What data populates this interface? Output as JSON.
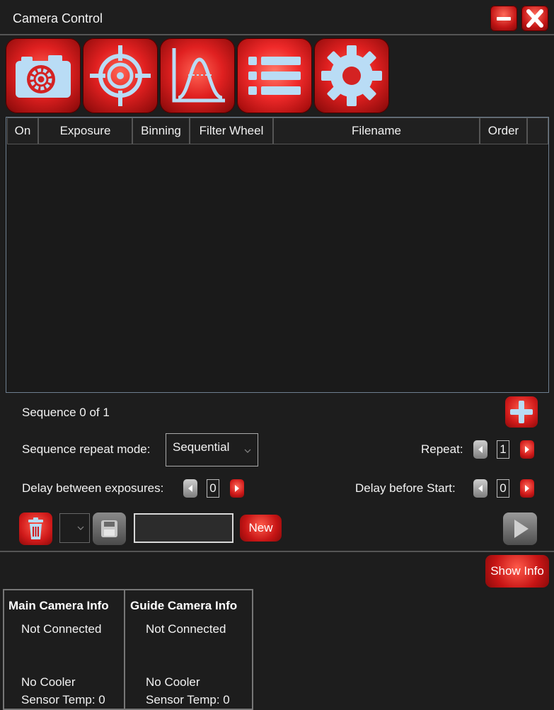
{
  "window": {
    "title": "Camera Control",
    "minimize_icon": "minimize-icon",
    "close_icon": "close-icon"
  },
  "toolbar": {
    "buttons": [
      {
        "icon": "camera-settings-icon"
      },
      {
        "icon": "crosshair-target-icon"
      },
      {
        "icon": "histogram-curve-icon"
      },
      {
        "icon": "sequence-list-icon"
      },
      {
        "icon": "gear-icon"
      }
    ]
  },
  "table": {
    "columns": [
      "On",
      "Exposure",
      "Binning",
      "Filter Wheel",
      "Filename",
      "Order"
    ],
    "rows": []
  },
  "sequence": {
    "status": "Sequence 0 of 1",
    "repeat_mode_label": "Sequence repeat mode:",
    "repeat_mode_value": "Sequential",
    "repeat_label": "Repeat:",
    "repeat_value": "1",
    "delay_between_label": "Delay between exposures:",
    "delay_between_value": "0",
    "delay_start_label": "Delay before Start:",
    "delay_start_value": "0",
    "new_label": "New",
    "name_value": "",
    "add_icon": "plus-icon",
    "delete_icon": "trash-icon",
    "save_icon": "save-icon",
    "play_icon": "play-icon"
  },
  "info": {
    "show_info_label": "Show Info",
    "main_camera": {
      "title": "Main Camera Info",
      "connection": "Not Connected",
      "cooler": "No Cooler",
      "sensor_temp": "Sensor Temp: 0"
    },
    "guide_camera": {
      "title": "Guide Camera Info",
      "connection": "Not Connected",
      "cooler": "No Cooler",
      "sensor_temp": "Sensor Temp: 0"
    }
  },
  "colors": {
    "accent_red": "#d41a1a",
    "background": "#1d1d1d",
    "icon_blue": "#a9d4f2"
  }
}
